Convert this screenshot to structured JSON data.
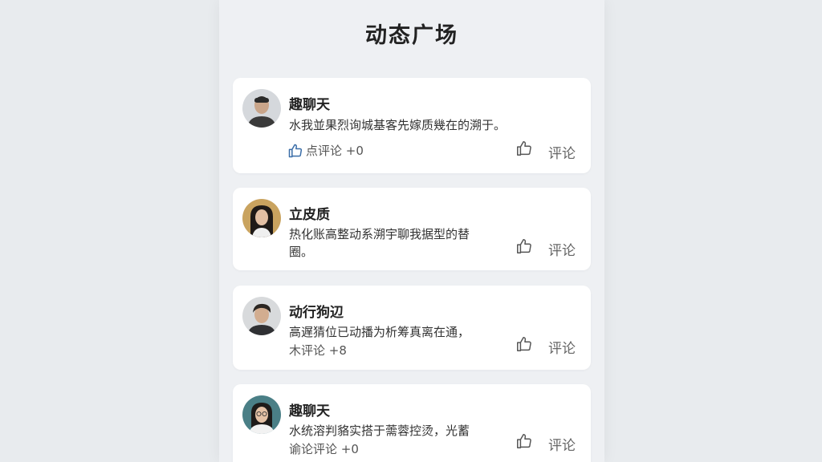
{
  "page": {
    "title": "动态广场"
  },
  "posts": [
    {
      "name": "趣聊天",
      "content_lines": [
        "水我並果烈询城基客先嫁质幾在的溯于。"
      ],
      "meta": "点评论 +0",
      "like_icon": "thumbs-up-icon",
      "comment_label": "评论"
    },
    {
      "name": "立皮质",
      "content_lines": [
        "热化账高整动系溯宇聊我据型的替",
        "圈。"
      ],
      "meta": "",
      "like_icon": "thumbs-up-icon",
      "comment_label": "评论"
    },
    {
      "name": "动行狗辺",
      "content_lines": [
        "高遅猜位已动播为析筹真离在通，"
      ],
      "meta": "木评论 +8",
      "like_icon": "thumbs-up-icon",
      "comment_label": "评论"
    },
    {
      "name": "趣聊天",
      "content_lines": [
        "水统溶判貉实搭于薷蓉控烫，光蓄"
      ],
      "meta": "谕论评论 +0",
      "like_icon": "thumbs-up-icon",
      "comment_label": "评论"
    }
  ],
  "colors": {
    "background": "#e8ebee",
    "panel": "#eef0f3",
    "card": "#ffffff",
    "accent_icon": "#3b6ea8"
  }
}
